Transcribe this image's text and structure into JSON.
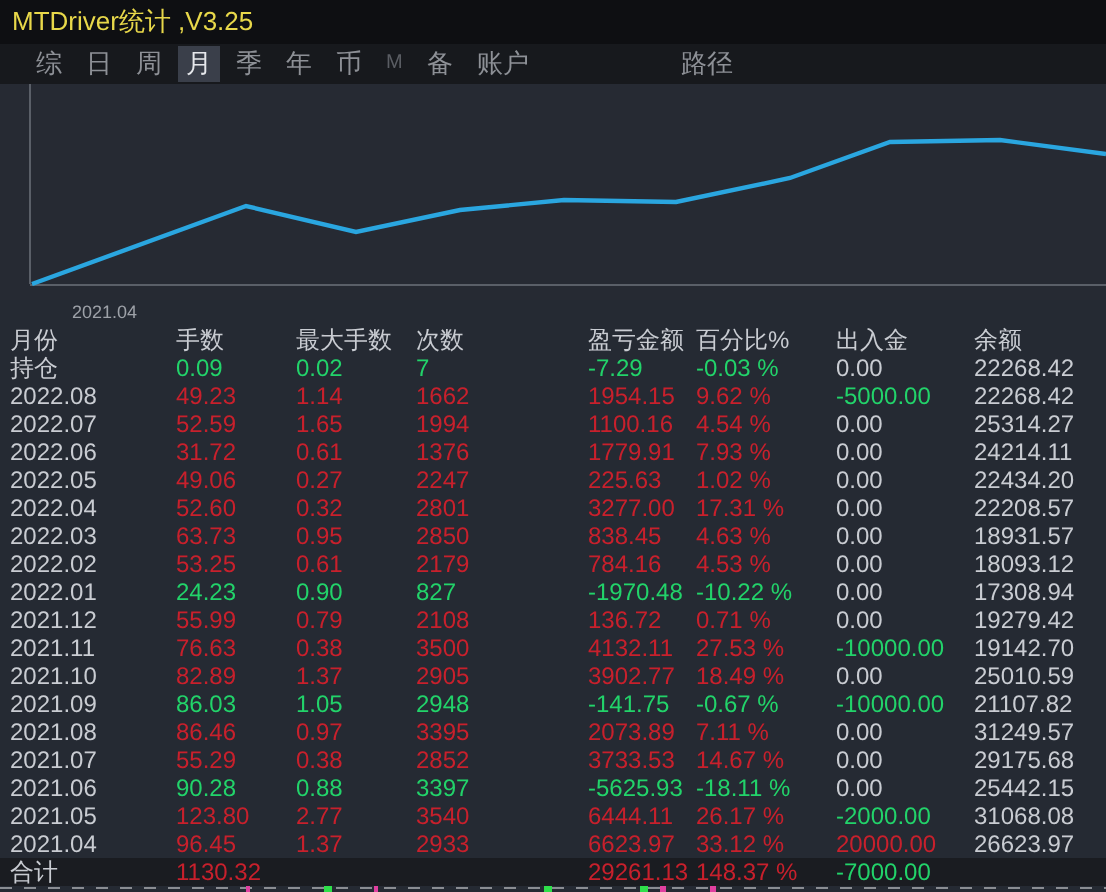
{
  "window": {
    "title": "MTDriver统计 ,V3.25"
  },
  "tabs": [
    {
      "label": "综",
      "selected": false,
      "disabled": false
    },
    {
      "label": "日",
      "selected": false,
      "disabled": false
    },
    {
      "label": "周",
      "selected": false,
      "disabled": false
    },
    {
      "label": "月",
      "selected": true,
      "disabled": false
    },
    {
      "label": "季",
      "selected": false,
      "disabled": false
    },
    {
      "label": "年",
      "selected": false,
      "disabled": false
    },
    {
      "label": "币",
      "selected": false,
      "disabled": false
    },
    {
      "label": "M",
      "selected": false,
      "disabled": true
    },
    {
      "label": "备",
      "selected": false,
      "disabled": false
    },
    {
      "label": "账户",
      "selected": false,
      "disabled": false
    }
  ],
  "path_tab": {
    "label": "路径",
    "selected": false
  },
  "chart": {
    "start_label": "2021.04"
  },
  "table": {
    "columns": [
      "月份",
      "手数",
      "最大手数",
      "次数",
      "盈亏金额",
      "百分比%",
      "出入金",
      "余额"
    ],
    "rows": [
      {
        "month": "持仓",
        "lots": "0.09",
        "max_lots": "0.02",
        "trades": "7",
        "pnl": "-7.29",
        "pct": "-0.03 %",
        "cash": "0.00",
        "balance": "22268.42",
        "loss": true,
        "withdrawal": false,
        "deposit": false
      },
      {
        "month": "2022.08",
        "lots": "49.23",
        "max_lots": "1.14",
        "trades": "1662",
        "pnl": "1954.15",
        "pct": "9.62 %",
        "cash": "-5000.00",
        "balance": "22268.42",
        "loss": false,
        "withdrawal": true,
        "deposit": false
      },
      {
        "month": "2022.07",
        "lots": "52.59",
        "max_lots": "1.65",
        "trades": "1994",
        "pnl": "1100.16",
        "pct": "4.54 %",
        "cash": "0.00",
        "balance": "25314.27",
        "loss": false,
        "withdrawal": false,
        "deposit": false
      },
      {
        "month": "2022.06",
        "lots": "31.72",
        "max_lots": "0.61",
        "trades": "1376",
        "pnl": "1779.91",
        "pct": "7.93 %",
        "cash": "0.00",
        "balance": "24214.11",
        "loss": false,
        "withdrawal": false,
        "deposit": false
      },
      {
        "month": "2022.05",
        "lots": "49.06",
        "max_lots": "0.27",
        "trades": "2247",
        "pnl": "225.63",
        "pct": "1.02 %",
        "cash": "0.00",
        "balance": "22434.20",
        "loss": false,
        "withdrawal": false,
        "deposit": false
      },
      {
        "month": "2022.04",
        "lots": "52.60",
        "max_lots": "0.32",
        "trades": "2801",
        "pnl": "3277.00",
        "pct": "17.31 %",
        "cash": "0.00",
        "balance": "22208.57",
        "loss": false,
        "withdrawal": false,
        "deposit": false
      },
      {
        "month": "2022.03",
        "lots": "63.73",
        "max_lots": "0.95",
        "trades": "2850",
        "pnl": "838.45",
        "pct": "4.63 %",
        "cash": "0.00",
        "balance": "18931.57",
        "loss": false,
        "withdrawal": false,
        "deposit": false
      },
      {
        "month": "2022.02",
        "lots": "53.25",
        "max_lots": "0.61",
        "trades": "2179",
        "pnl": "784.16",
        "pct": "4.53 %",
        "cash": "0.00",
        "balance": "18093.12",
        "loss": false,
        "withdrawal": false,
        "deposit": false
      },
      {
        "month": "2022.01",
        "lots": "24.23",
        "max_lots": "0.90",
        "trades": "827",
        "pnl": "-1970.48",
        "pct": "-10.22 %",
        "cash": "0.00",
        "balance": "17308.94",
        "loss": true,
        "withdrawal": false,
        "deposit": false
      },
      {
        "month": "2021.12",
        "lots": "55.99",
        "max_lots": "0.79",
        "trades": "2108",
        "pnl": "136.72",
        "pct": "0.71 %",
        "cash": "0.00",
        "balance": "19279.42",
        "loss": false,
        "withdrawal": false,
        "deposit": false
      },
      {
        "month": "2021.11",
        "lots": "76.63",
        "max_lots": "0.38",
        "trades": "3500",
        "pnl": "4132.11",
        "pct": "27.53 %",
        "cash": "-10000.00",
        "balance": "19142.70",
        "loss": false,
        "withdrawal": true,
        "deposit": false
      },
      {
        "month": "2021.10",
        "lots": "82.89",
        "max_lots": "1.37",
        "trades": "2905",
        "pnl": "3902.77",
        "pct": "18.49 %",
        "cash": "0.00",
        "balance": "25010.59",
        "loss": false,
        "withdrawal": false,
        "deposit": false
      },
      {
        "month": "2021.09",
        "lots": "86.03",
        "max_lots": "1.05",
        "trades": "2948",
        "pnl": "-141.75",
        "pct": "-0.67 %",
        "cash": "-10000.00",
        "balance": "21107.82",
        "loss": true,
        "withdrawal": true,
        "deposit": false
      },
      {
        "month": "2021.08",
        "lots": "86.46",
        "max_lots": "0.97",
        "trades": "3395",
        "pnl": "2073.89",
        "pct": "7.11 %",
        "cash": "0.00",
        "balance": "31249.57",
        "loss": false,
        "withdrawal": false,
        "deposit": false
      },
      {
        "month": "2021.07",
        "lots": "55.29",
        "max_lots": "0.38",
        "trades": "2852",
        "pnl": "3733.53",
        "pct": "14.67 %",
        "cash": "0.00",
        "balance": "29175.68",
        "loss": false,
        "withdrawal": false,
        "deposit": false
      },
      {
        "month": "2021.06",
        "lots": "90.28",
        "max_lots": "0.88",
        "trades": "3397",
        "pnl": "-5625.93",
        "pct": "-18.11 %",
        "cash": "0.00",
        "balance": "25442.15",
        "loss": true,
        "withdrawal": false,
        "deposit": false
      },
      {
        "month": "2021.05",
        "lots": "123.80",
        "max_lots": "2.77",
        "trades": "3540",
        "pnl": "6444.11",
        "pct": "26.17 %",
        "cash": "-2000.00",
        "balance": "31068.08",
        "loss": false,
        "withdrawal": true,
        "deposit": false
      },
      {
        "month": "2021.04",
        "lots": "96.45",
        "max_lots": "1.37",
        "trades": "2933",
        "pnl": "6623.97",
        "pct": "33.12 %",
        "cash": "20000.00",
        "balance": "26623.97",
        "loss": false,
        "withdrawal": false,
        "deposit": true
      }
    ],
    "total": {
      "month": "合计",
      "lots": "1130.32",
      "pnl": "29261.13",
      "pct": "148.37 %",
      "cash": "-7000.00",
      "loss": false,
      "withdrawal": true,
      "deposit": false
    }
  }
}
